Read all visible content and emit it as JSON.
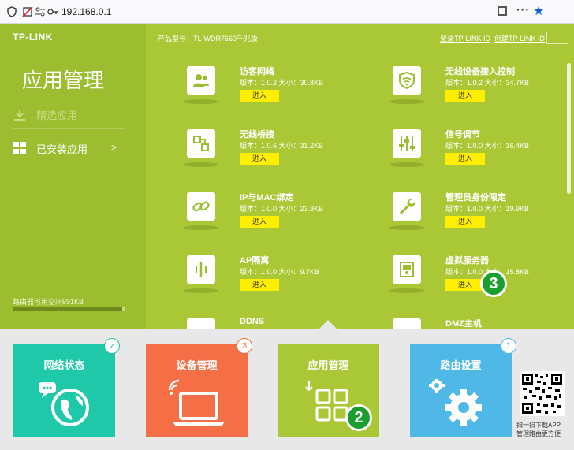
{
  "browser": {
    "url": "192.168.0.1",
    "icons": [
      "shield-icon",
      "blocked-tracker-icon",
      "permissions-icon",
      "key-icon",
      "qr-icon",
      "more-icon",
      "bookmark-star-icon"
    ]
  },
  "header": {
    "logo": "TP-LINK",
    "model": "产品型号：TL-WDR7660千兆版",
    "login_link": "登录TP-LINK ID",
    "create_link": "创建TP-LINK ID"
  },
  "sidebar": {
    "title": "应用管理",
    "items": [
      {
        "label": "精选应用",
        "icon": "download-icon"
      },
      {
        "label": "已安装应用",
        "icon": "grid-icon",
        "arrow": ">"
      }
    ],
    "storage_text": "路由器可用空间691KB",
    "storage_used_fraction": 0.97
  },
  "apps": [
    {
      "name": "访客网络",
      "meta": "版本：1.0.2 大小：30.8KB",
      "button": "进入",
      "icon": "guest-users-icon"
    },
    {
      "name": "无线设备接入控制",
      "meta": "版本：1.0.2 大小：34.7KB",
      "button": "进入",
      "icon": "wifi-shield-icon"
    },
    {
      "name": "无线桥接",
      "meta": "版本：1.0.6 大小：31.2KB",
      "button": "进入",
      "icon": "bridge-icon"
    },
    {
      "name": "信号调节",
      "meta": "版本：1.0.0 大小：16.4KB",
      "button": "进入",
      "icon": "sliders-icon"
    },
    {
      "name": "IP与MAC绑定",
      "meta": "版本：1.0.0 大小：23.9KB",
      "button": "进入",
      "icon": "link-icon"
    },
    {
      "name": "管理员身份限定",
      "meta": "版本：1.0.0 大小：19.9KB",
      "button": "进入",
      "icon": "wrench-icon"
    },
    {
      "name": "AP隔离",
      "meta": "版本：1.0.0 大小：9.7KB",
      "button": "进入",
      "icon": "ap-isolation-icon"
    },
    {
      "name": "虚拟服务器",
      "meta": "版本：1.0.0 大小：15.8KB",
      "button": "进入",
      "icon": "server-icon"
    },
    {
      "name": "DDNS",
      "icon_text": "DD",
      "icon": "ddns-icon"
    },
    {
      "name": "DMZ主机",
      "icon_text": "DM",
      "icon": "dmz-icon"
    }
  ],
  "callouts": {
    "apps": "3",
    "tile": "2"
  },
  "tiles": [
    {
      "title": "网络状态",
      "badge": "✓",
      "color": "#1fc8a8",
      "badge_color": "#1fc8a8",
      "icon": "globe-chat-icon"
    },
    {
      "title": "设备管理",
      "badge": "3",
      "color": "#f46f45",
      "badge_color": "#f46f45",
      "icon": "laptop-wifi-icon"
    },
    {
      "title": "应用管理",
      "badge": "",
      "color": "#aac735",
      "badge_color": "#aac735",
      "icon": "apps-grid-icon"
    },
    {
      "title": "路由设置",
      "badge": "1",
      "color": "#4fb8e6",
      "badge_color": "#4fb8e6",
      "icon": "gears-icon"
    }
  ],
  "qr_caption": [
    "扫一扫下载APP",
    "管理路由更方便"
  ]
}
